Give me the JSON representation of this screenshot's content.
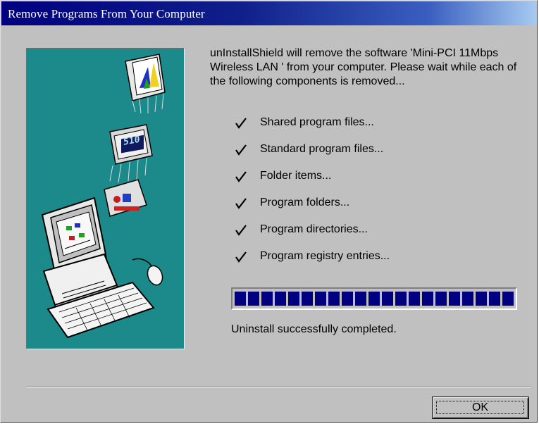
{
  "window": {
    "title": "Remove Programs From Your Computer"
  },
  "art": {
    "badge_text": "510"
  },
  "intro": {
    "text": "unInstallShield will remove the software 'Mini-PCI 11Mbps Wireless LAN ' from your computer.  Please wait while each of the following components is removed..."
  },
  "components": [
    {
      "label": "Shared program files...",
      "done": true
    },
    {
      "label": "Standard program files...",
      "done": true
    },
    {
      "label": "Folder items...",
      "done": true
    },
    {
      "label": "Program folders...",
      "done": true
    },
    {
      "label": "Program directories...",
      "done": true
    },
    {
      "label": "Program registry entries...",
      "done": true
    }
  ],
  "progress": {
    "fraction": 1.0,
    "color": "#000080"
  },
  "status": {
    "text": "Uninstall successfully completed."
  },
  "buttons": {
    "ok_label": "OK"
  },
  "colors": {
    "title_bar": "#000080",
    "dialog": "#c0c0c0",
    "art_background": "#1c8a8a"
  }
}
